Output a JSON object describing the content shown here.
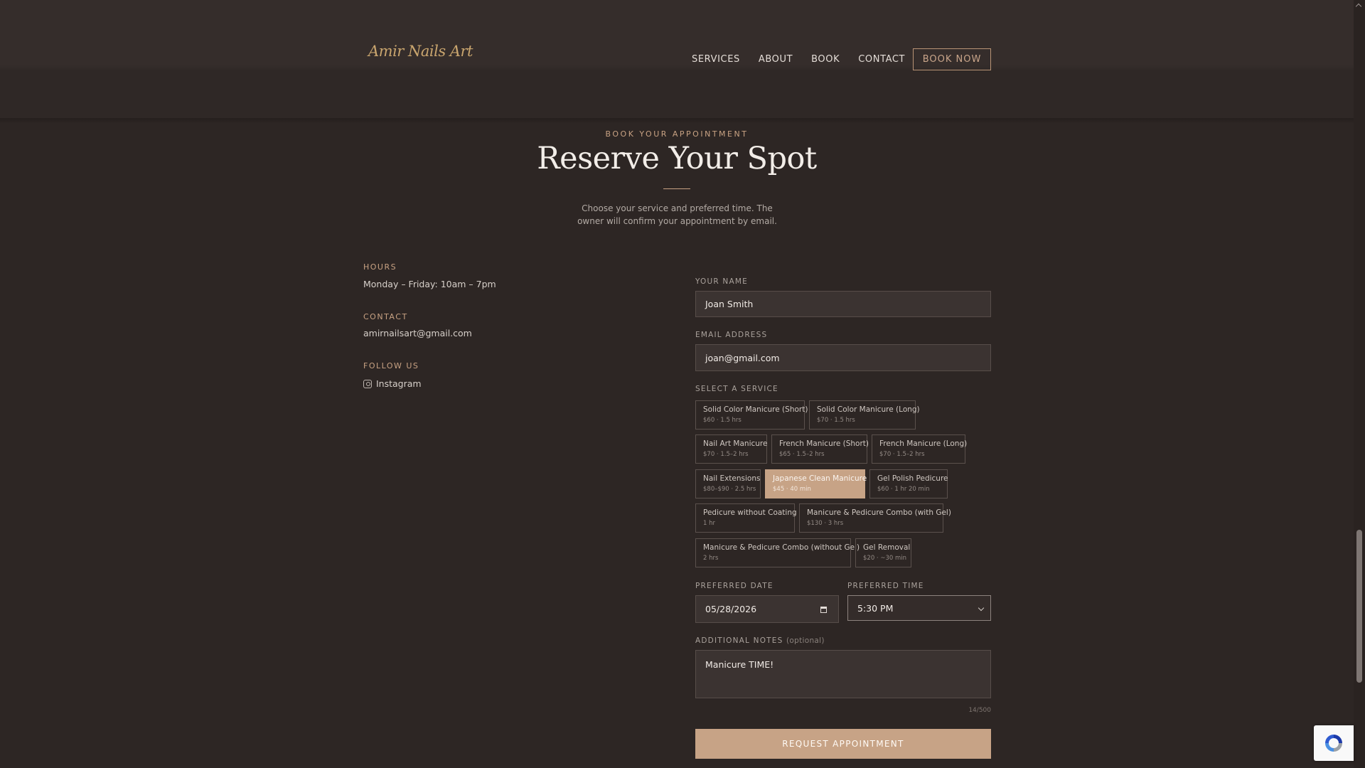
{
  "brand": {
    "logo_text": "Amir Nails Art"
  },
  "nav": {
    "items": [
      "SERVICES",
      "ABOUT",
      "BOOK",
      "CONTACT"
    ],
    "book_now": "BOOK NOW"
  },
  "hero": {
    "eyebrow": "BOOK YOUR APPOINTMENT",
    "title": "Reserve Your Spot",
    "subtitle": "Choose your service and preferred time. The owner will confirm your appointment by email."
  },
  "info": {
    "hours_label": "HOURS",
    "hours_value": "Monday – Friday: 10am – 7pm",
    "contact_label": "CONTACT",
    "contact_value": "amirnailsart@gmail.com",
    "follow_label": "FOLLOW US",
    "instagram": "Instagram"
  },
  "form": {
    "name_label": "YOUR NAME",
    "name_value": "Joan Smith",
    "email_label": "EMAIL ADDRESS",
    "email_value": "joan@gmail.com",
    "service_label": "SELECT A SERVICE",
    "services": [
      {
        "name": "Solid Color Manicure (Short)",
        "meta": "$60 · 1.5 hrs"
      },
      {
        "name": "Solid Color Manicure (Long)",
        "meta": "$70 · 1.5 hrs"
      },
      {
        "name": "Nail Art Manicure",
        "meta": "$70 · 1.5–2 hrs"
      },
      {
        "name": "French Manicure (Short)",
        "meta": "$65 · 1.5–2 hrs"
      },
      {
        "name": "French Manicure (Long)",
        "meta": "$70 · 1.5–2 hrs"
      },
      {
        "name": "Nail Extensions",
        "meta": "$80–$90 · 2.5 hrs"
      },
      {
        "name": "Japanese Clean Manicure",
        "meta": "$45 · 40 min",
        "selected": true
      },
      {
        "name": "Gel Polish Pedicure",
        "meta": "$60 · 1 hr 20 min"
      },
      {
        "name": "Pedicure without Coating",
        "meta": "1 hr"
      },
      {
        "name": "Manicure & Pedicure Combo (with Gel)",
        "meta": "$130 · 3 hrs"
      },
      {
        "name": "Manicure & Pedicure Combo (without Gel)",
        "meta": "2 hrs"
      },
      {
        "name": "Gel Removal",
        "meta": "$20 · ~30 min"
      }
    ],
    "date_label": "PREFERRED DATE",
    "date_value": "05/28/2026",
    "time_label": "PREFERRED TIME",
    "time_value": "5:30 PM",
    "notes_label": "ADDITIONAL NOTES",
    "notes_optional": "(optional)",
    "notes_value": "Manicure TIME!",
    "counter": "14/500",
    "submit": "REQUEST APPOINTMENT"
  },
  "colors": {
    "accent": "#c7a386",
    "background": "#2d2624",
    "field": "#3b3331"
  }
}
